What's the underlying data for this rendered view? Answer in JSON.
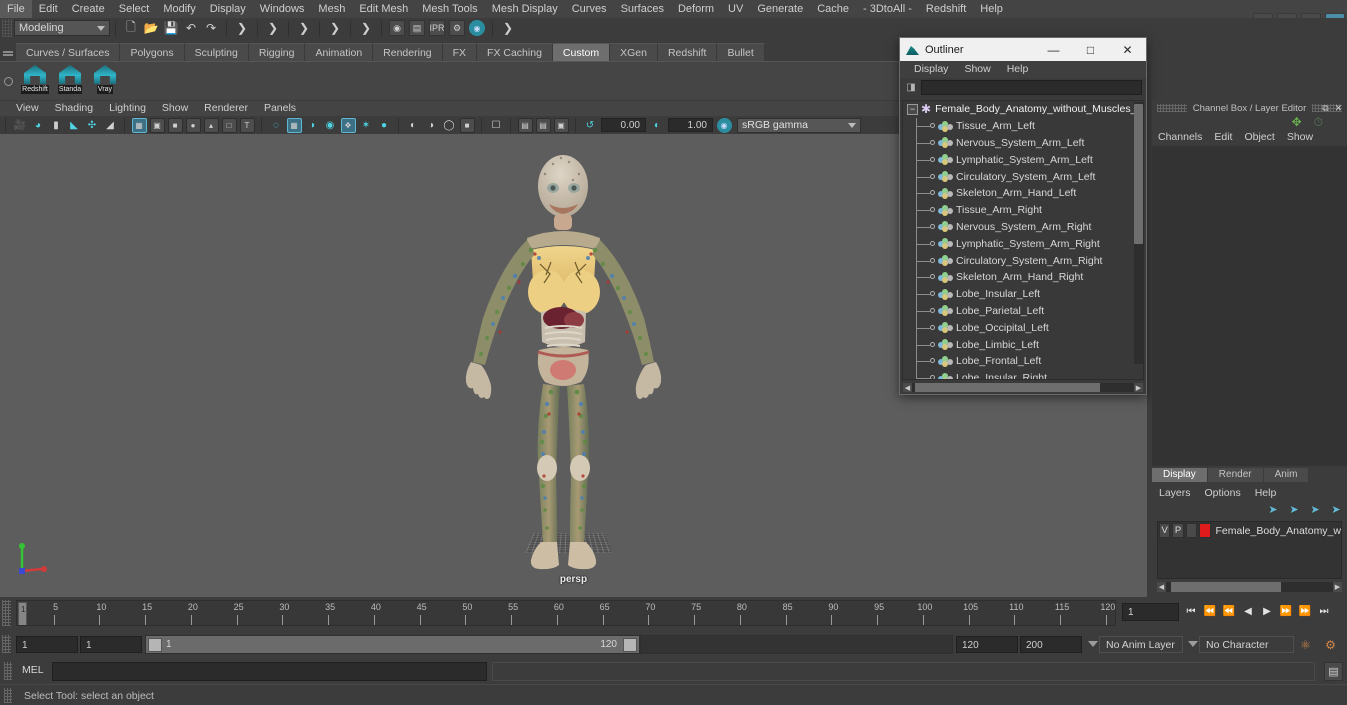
{
  "app": {
    "title": "Autodesk Maya",
    "mode": "Modeling"
  },
  "menubar": {
    "items": [
      "File",
      "Edit",
      "Create",
      "Select",
      "Modify",
      "Display",
      "Windows",
      "Mesh",
      "Edit Mesh",
      "Mesh Tools",
      "Mesh Display",
      "Curves",
      "Surfaces",
      "Deform",
      "UV",
      "Generate",
      "Cache",
      "- 3DtoAll -",
      "Redshift",
      "Help"
    ]
  },
  "statusbar_icons": {
    "file_new": "new-file-icon",
    "file_open": "open-folder-icon",
    "file_save": "save-disk-icon",
    "undo": "undo-arrow-icon",
    "redo": "redo-arrow-icon",
    "render": "render-camera-icon",
    "render_sequence": "render-sequence-icon",
    "ipr": "ipr-render-icon",
    "render_settings": "render-settings-icon",
    "render_globals": "render-globals-icon"
  },
  "topright_icons": [
    "toggle-modeling-toolkit-icon",
    "toggle-attribute-editor-icon",
    "toggle-tool-settings-icon",
    "toggle-channel-box-icon"
  ],
  "shelf": {
    "tabs": [
      "Curves / Surfaces",
      "Polygons",
      "Sculpting",
      "Rigging",
      "Animation",
      "Rendering",
      "FX",
      "FX Caching",
      "Custom",
      "XGen",
      "Redshift",
      "Bullet"
    ],
    "active_tab": "Custom",
    "buttons": [
      {
        "label": "Redshift",
        "icon": "redshift-shelf-icon"
      },
      {
        "label": "Standa",
        "icon": "standard-shelf-icon"
      },
      {
        "label": "Vray",
        "icon": "vray-shelf-icon"
      }
    ]
  },
  "viewport": {
    "menus": [
      "View",
      "Shading",
      "Lighting",
      "Show",
      "Renderer",
      "Panels"
    ],
    "camera_label": "persp",
    "exposure": "0.00",
    "gamma": "1.00",
    "color_space": "sRGB gamma",
    "background_color": "#5d5d5d"
  },
  "outliner": {
    "window_title": "Outliner",
    "window_controls": {
      "minimize": "—",
      "maximize": "▫",
      "close": "✕"
    },
    "menus": [
      "Display",
      "Show",
      "Help"
    ],
    "search_placeholder": "",
    "search_value": "",
    "root": "Female_Body_Anatomy_without_Muscles_",
    "items": [
      "Tissue_Arm_Left",
      "Nervous_System_Arm_Left",
      "Lymphatic_System_Arm_Left",
      "Circulatory_System_Arm_Left",
      "Skeleton_Arm_Hand_Left",
      "Tissue_Arm_Right",
      "Nervous_System_Arm_Right",
      "Lymphatic_System_Arm_Right",
      "Circulatory_System_Arm_Right",
      "Skeleton_Arm_Hand_Right",
      "Lobe_Insular_Left",
      "Lobe_Parietal_Left",
      "Lobe_Occipital_Left",
      "Lobe_Limbic_Left",
      "Lobe_Frontal_Left",
      "Lobe_Insular_Right"
    ]
  },
  "channel_box": {
    "title": "Channel Box / Layer Editor",
    "menus": [
      "Channels",
      "Edit",
      "Object",
      "Show"
    ],
    "tabs": [
      "Display",
      "Render",
      "Anim"
    ],
    "active_tab": "Display",
    "layer_menus": [
      "Layers",
      "Options",
      "Help"
    ],
    "layers": [
      {
        "visible": "V",
        "playback": "P",
        "color": "#e01b1b",
        "name": "Female_Body_Anatomy_w"
      }
    ]
  },
  "timeline": {
    "ticks": [
      5,
      10,
      15,
      20,
      25,
      30,
      35,
      40,
      45,
      50,
      55,
      60,
      65,
      70,
      75,
      80,
      85,
      90,
      95,
      100,
      105,
      110,
      115,
      120
    ],
    "current_frame": "1",
    "cursor_label": "1",
    "transport": [
      "go-to-start-icon",
      "step-back-frame-icon",
      "step-back-key-icon",
      "play-backwards-icon",
      "play-forwards-icon",
      "step-forward-key-icon",
      "step-forward-frame-icon",
      "go-to-end-icon"
    ]
  },
  "range": {
    "anim_start": "1",
    "range_start": "1",
    "slider_start_label": "1",
    "slider_end_label": "120",
    "range_end": "120",
    "anim_end": "200",
    "anim_layer": "No Anim Layer",
    "character_set": "No Character Set",
    "icons": [
      "auto-key-icon",
      "animation-preferences-icon"
    ]
  },
  "command_line": {
    "language": "MEL",
    "input_value": "",
    "output_value": "",
    "script_editor_icon": "script-editor-icon"
  },
  "help_line": {
    "text": "Select Tool: select an object"
  }
}
